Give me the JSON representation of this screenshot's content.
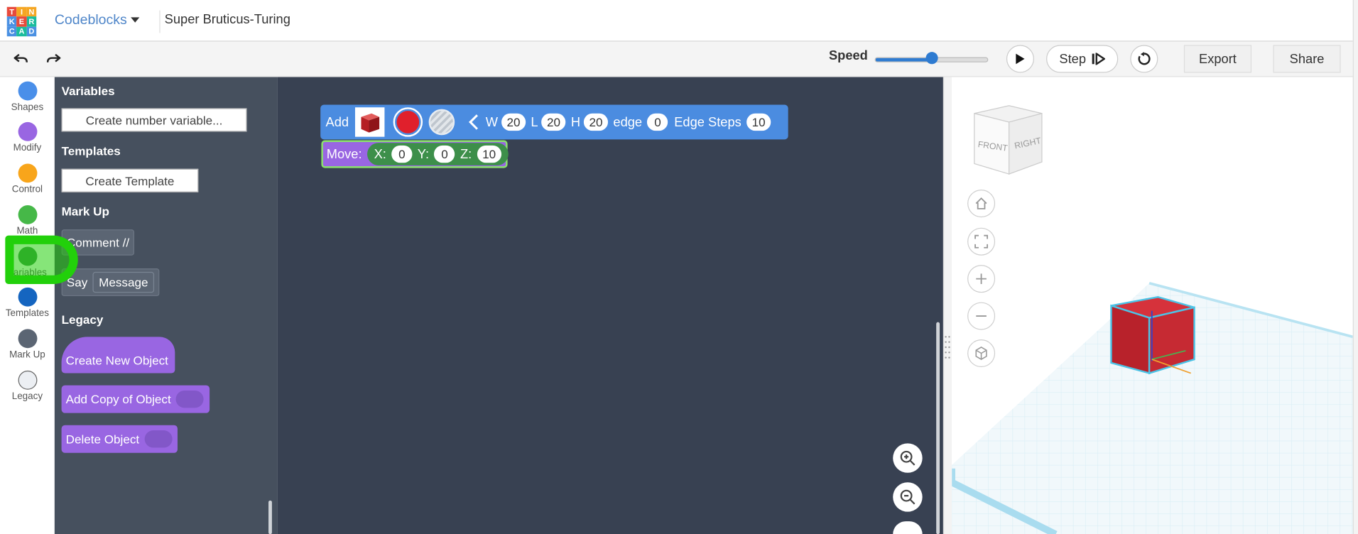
{
  "header": {
    "logo_letters": [
      "T",
      "I",
      "N",
      "K",
      "E",
      "R",
      "C",
      "A",
      "D"
    ],
    "logo_colors": [
      "#e84a3c",
      "#f5a623",
      "#f5a623",
      "#4a90e2",
      "#e84a3c",
      "#1abc9c",
      "#4a90e2",
      "#1abc9c",
      "#4a90e2"
    ],
    "app_name": "Codeblocks",
    "project_title": "Super Bruticus-Turing"
  },
  "toolbar": {
    "speed_label": "Speed",
    "speed_fraction": 0.5,
    "step_label": "Step",
    "export_label": "Export",
    "share_label": "Share"
  },
  "categories": [
    {
      "label": "Shapes",
      "color": "#4a8fe9"
    },
    {
      "label": "Modify",
      "color": "#9966e2"
    },
    {
      "label": "Control",
      "color": "#f8a51b"
    },
    {
      "label": "Math",
      "color": "#46b848"
    },
    {
      "label": "Variables",
      "color": "#3d8f4a"
    },
    {
      "label": "Templates",
      "color": "#1565c0"
    },
    {
      "label": "Mark Up",
      "color": "#5b6573"
    },
    {
      "label": "Legacy",
      "color": "#eceff3"
    }
  ],
  "flyout": {
    "variables_heading": "Variables",
    "create_variable_label": "Create number variable...",
    "templates_heading": "Templates",
    "create_template_label": "Create Template",
    "markup_heading": "Mark Up",
    "comment_label": "Comment //",
    "say_label": "Say",
    "message_label": "Message",
    "legacy_heading": "Legacy",
    "create_new_object_label": "Create New Object",
    "add_copy_label": "Add Copy of Object",
    "delete_object_label": "Delete Object"
  },
  "workspace": {
    "add_block": {
      "add_label": "Add",
      "color_hex": "#e0202c",
      "w_label": "W",
      "w_value": "20",
      "l_label": "L",
      "l_value": "20",
      "h_label": "H",
      "h_value": "20",
      "edge_label": "edge",
      "edge_value": "0",
      "edge_steps_label": "Edge Steps",
      "edge_steps_value": "10"
    },
    "move_block": {
      "move_label": "Move:",
      "x_label": "X:",
      "x_value": "0",
      "y_label": "Y:",
      "y_value": "0",
      "z_label": "Z:",
      "z_value": "10"
    }
  },
  "viewcube": {
    "front_label": "FRONT",
    "right_label": "RIGHT"
  }
}
